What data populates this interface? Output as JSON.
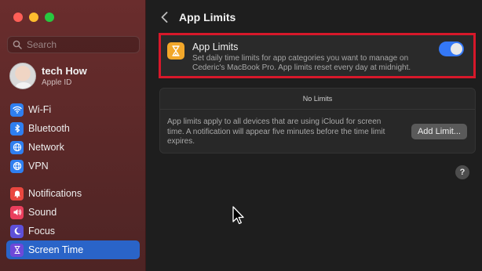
{
  "window": {
    "traffic_lights": {
      "close": "#ff5f57",
      "minimize": "#febc2e",
      "maximize": "#28c840"
    }
  },
  "sidebar": {
    "search_placeholder": "Search",
    "profile": {
      "name": "tech How",
      "subtitle": "Apple ID"
    },
    "items": [
      {
        "label": "Wi-Fi",
        "icon": "wifi-icon",
        "color": "#2f7ff0"
      },
      {
        "label": "Bluetooth",
        "icon": "bluetooth-icon",
        "color": "#2f7ff0"
      },
      {
        "label": "Network",
        "icon": "globe-icon",
        "color": "#2f7ff0"
      },
      {
        "label": "VPN",
        "icon": "vpn-globe-icon",
        "color": "#2f7ff0"
      },
      {
        "label": "Notifications",
        "icon": "bell-icon",
        "color": "#e9473f"
      },
      {
        "label": "Sound",
        "icon": "speaker-icon",
        "color": "#ea3f5d"
      },
      {
        "label": "Focus",
        "icon": "moon-icon",
        "color": "#5e50d8"
      },
      {
        "label": "Screen Time",
        "icon": "hourglass-icon",
        "color": "#6e49d8",
        "selected": true
      }
    ]
  },
  "main": {
    "title": "App Limits",
    "app_limits": {
      "title": "App Limits",
      "description": "Set daily time limits for app categories you want to manage on Cederic's MacBook Pro. App limits reset every day at midnight.",
      "enabled": true
    },
    "panel": {
      "empty_label": "No Limits",
      "info": "App limits apply to all devices that are using iCloud for screen time. A notification will appear five minutes before the time limit expires.",
      "add_button": "Add Limit..."
    },
    "help_label": "?"
  },
  "colors": {
    "accent": "#3478f6",
    "highlight_border": "#d7182a",
    "sidebar_bg": "#5c2a2a"
  }
}
